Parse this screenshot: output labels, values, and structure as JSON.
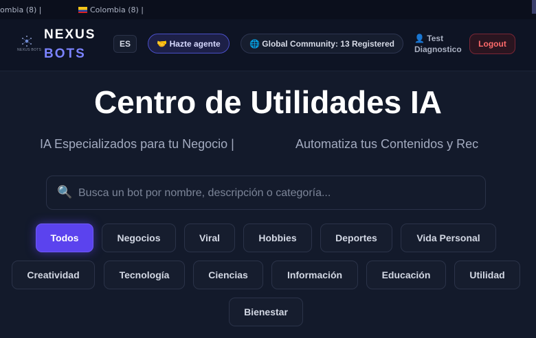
{
  "ticker": {
    "item1": "ombia (8)   |",
    "item2": "Colombia (8)   |"
  },
  "header": {
    "brand_line1": "NEXUS",
    "brand_line2": "BOTS",
    "logo_caption": "NEXUS BOTS",
    "lang": "ES",
    "agent_button": "🤝 Hazte agente",
    "community": "🌐 Global Community: 13 Registered",
    "user_line1": "👤 Test",
    "user_line2": "Diagnostico",
    "logout": "Logout"
  },
  "hero": {
    "title": "Centro de Utilidades IA",
    "marquee_1": "IA Especializados para tu Negocio  |",
    "marquee_2": "Automatiza tus Contenidos y Rec"
  },
  "search": {
    "icon": "🔍",
    "placeholder": "Busca un bot por nombre, descripción o categoría..."
  },
  "categories": [
    "Todos",
    "Negocios",
    "Viral",
    "Hobbies",
    "Deportes",
    "Vida Personal",
    "Creatividad",
    "Tecnología",
    "Ciencias",
    "Información",
    "Educación",
    "Utilidad",
    "Bienestar"
  ],
  "colors": {
    "accent": "#5b43ee",
    "brand_secondary": "#7b83ff",
    "logout": "#ff6b6b"
  }
}
